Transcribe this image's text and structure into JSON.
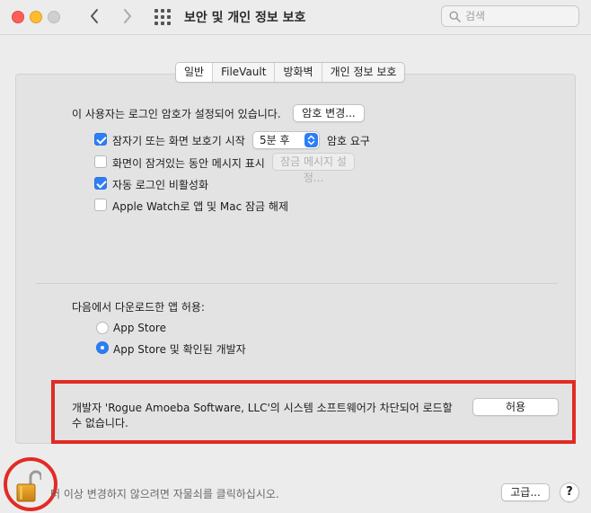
{
  "window": {
    "title": "보안 및 개인 정보 보호",
    "search_placeholder": "검색"
  },
  "tabs": [
    {
      "label": "일반",
      "active": true
    },
    {
      "label": "FileVault",
      "active": false
    },
    {
      "label": "방화벽",
      "active": false
    },
    {
      "label": "개인 정보 보호",
      "active": false
    }
  ],
  "general": {
    "password_text": "이 사용자는 로그인 암호가 설정되어 있습니다.",
    "change_password_label": "암호 변경...",
    "require_password": {
      "label": "잠자기 또는 화면 보호기 시작",
      "checked": true,
      "delay": "5분 후",
      "suffix": "암호 요구"
    },
    "show_message": {
      "label": "화면이 잠겨있는 동안 메시지 표시",
      "checked": false,
      "button": "잠금 메시지 설정..."
    },
    "disable_auto_login": {
      "label": "자동 로그인 비활성화",
      "checked": true
    },
    "apple_watch_unlock": {
      "label": "Apple Watch로 앱 및 Mac 잠금 해제",
      "checked": false
    }
  },
  "downloads": {
    "heading": "다음에서 다운로드한 앱 허용:",
    "options": [
      {
        "label": "App Store",
        "selected": false
      },
      {
        "label": "App Store 및 확인된 개발자",
        "selected": true
      }
    ]
  },
  "blocked": {
    "message_line1": "개발자 'Rogue Amoeba Software, LLC'의 시스템 소프트웨어가 차단되어 로드할",
    "message_line2": "수 없습니다.",
    "allow_label": "허용"
  },
  "footer": {
    "lock_text": "더 이상 변경하지 않으려면 자물쇠를 클릭하십시오.",
    "advanced_label": "고급...",
    "help_label": "?"
  },
  "colors": {
    "accent": "#2c7ef8",
    "annotation_red": "#e22b25"
  }
}
